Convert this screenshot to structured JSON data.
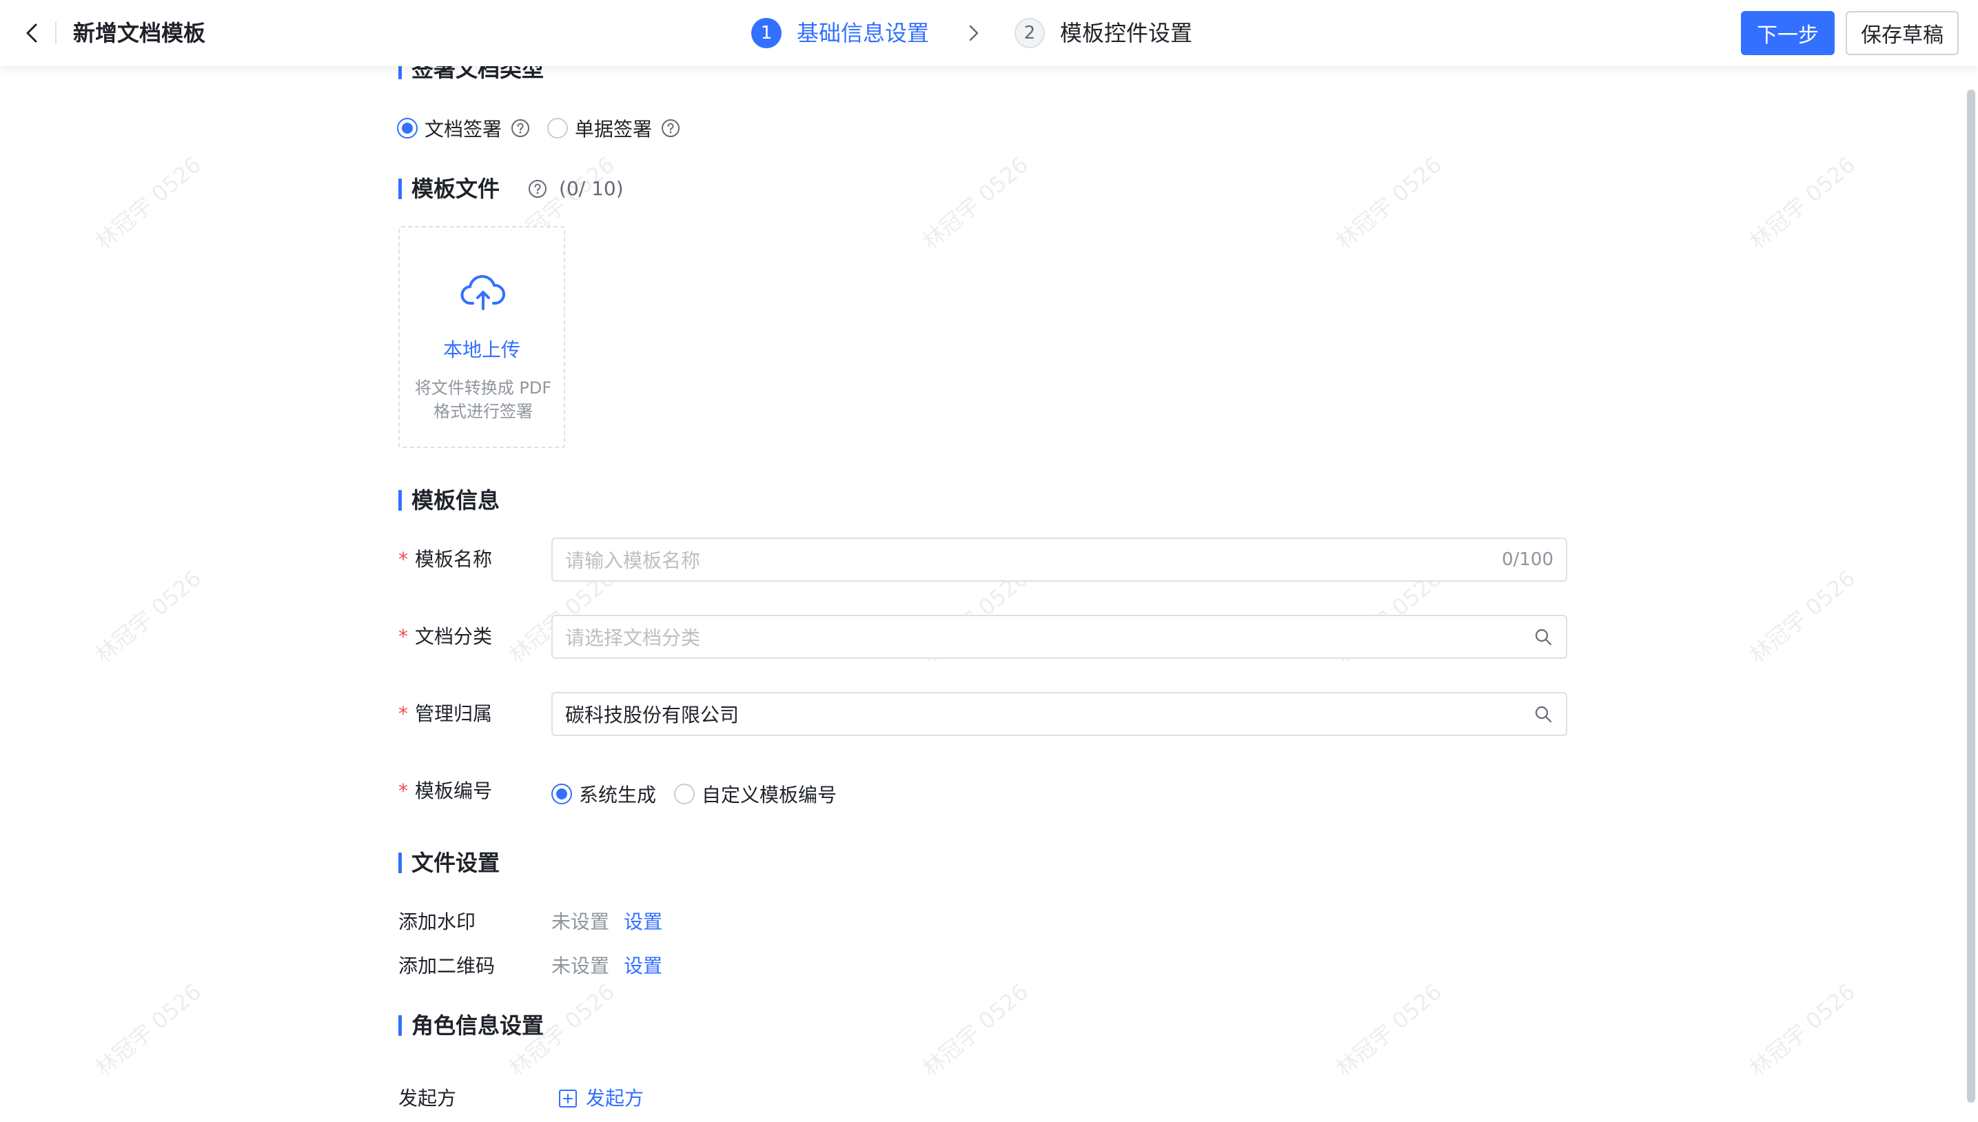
{
  "header": {
    "title": "新增文档模板",
    "steps": [
      {
        "num": "1",
        "label": "基础信息设置"
      },
      {
        "num": "2",
        "label": "模板控件设置"
      }
    ],
    "next_label": "下一步",
    "draft_label": "保存草稿"
  },
  "watermark": "林冠宇 0526",
  "sign_type": {
    "title": "签署文档类型",
    "options": [
      "文档签署",
      "单据签署"
    ],
    "selected": "文档签署"
  },
  "template_file": {
    "title": "模板文件",
    "count": "(0/ 10)",
    "upload_title": "本地上传",
    "upload_desc": "将文件转换成 PDF 格式进行签署"
  },
  "template_info": {
    "title": "模板信息",
    "name_label": "模板名称",
    "name_placeholder": "请输入模板名称",
    "name_count": "0/100",
    "category_label": "文档分类",
    "category_placeholder": "请选择文档分类",
    "owner_label": "管理归属",
    "owner_value": "碳科技股份有限公司",
    "number_label": "模板编号",
    "number_options": [
      "系统生成",
      "自定义模板编号"
    ],
    "number_selected": "系统生成"
  },
  "file_settings": {
    "title": "文件设置",
    "watermark_label": "添加水印",
    "watermark_status": "未设置",
    "watermark_action": "设置",
    "qrcode_label": "添加二维码",
    "qrcode_status": "未设置",
    "qrcode_action": "设置"
  },
  "role_settings": {
    "title": "角色信息设置",
    "initiator_label": "发起方",
    "add_initiator": "发起方"
  },
  "colors": {
    "accent": "#3370ff",
    "required": "#f54a45"
  }
}
